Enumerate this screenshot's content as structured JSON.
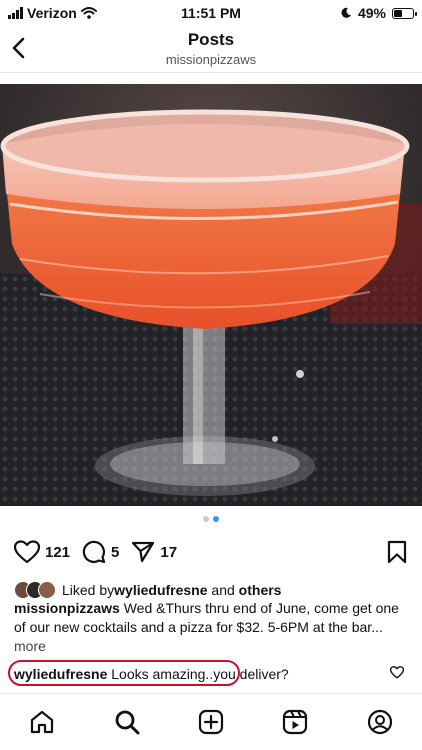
{
  "status": {
    "carrier": "Verizon",
    "time": "11:51 PM",
    "battery": "49%",
    "battery_level": 0.49
  },
  "header": {
    "title": "Posts",
    "username": "missionpizzaws"
  },
  "carousel": {
    "count": 2,
    "active": 2
  },
  "actions": {
    "likes": "121",
    "comments": "5",
    "shares": "17"
  },
  "liked_by": {
    "prefix": "Liked by ",
    "user": "wyliedufresne",
    "middle": " and ",
    "others": "others"
  },
  "caption": {
    "user": "missionpizzaws",
    "text": " Wed &Thurs thru end of June, come get one of our new cocktails and a pizza for $32. 5-6PM at the bar...",
    "more": " more"
  },
  "comment": {
    "user": "wyliedufresne",
    "text": " Looks amazing..you deliver?"
  },
  "icons": {
    "back": "chevron-left-icon",
    "like": "heart-icon",
    "comment": "speech-bubble-icon",
    "share": "paper-plane-icon",
    "save": "bookmark-icon",
    "nav": [
      "home-icon",
      "search-icon",
      "create-icon",
      "reels-icon",
      "profile-icon"
    ]
  },
  "colors": {
    "accent": "#3897f0",
    "highlight": "#c8102e",
    "cocktail": "#f2683a"
  }
}
